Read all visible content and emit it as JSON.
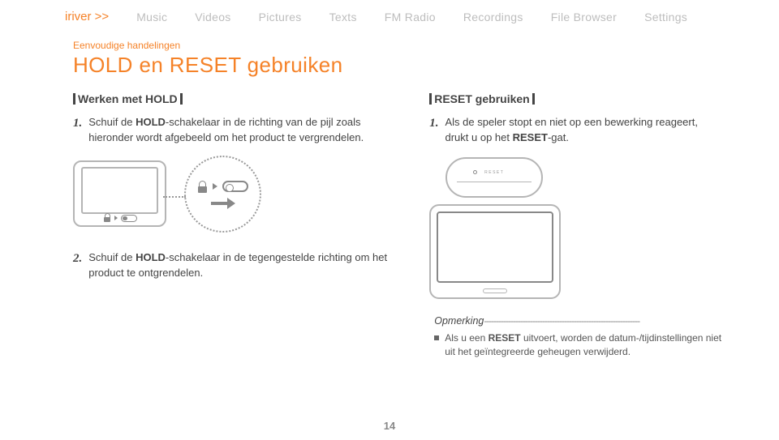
{
  "nav": {
    "brand": "iriver >>",
    "items": [
      "Music",
      "Videos",
      "Pictures",
      "Texts",
      "FM Radio",
      "Recordings",
      "File Browser",
      "Settings"
    ]
  },
  "section_label": "Eenvoudige handelingen",
  "page_title": "HOLD en RESET gebruiken",
  "left": {
    "subheader": "Werken met HOLD",
    "step1_num": "1.",
    "step1_prefix": "Schuif de ",
    "step1_bold": "HOLD",
    "step1_suffix": "-schakelaar in de richting van de pijl zoals hieronder wordt afgebeeld om het product te vergrendelen.",
    "step2_num": "2.",
    "step2_prefix": "Schuif de ",
    "step2_bold": "HOLD",
    "step2_suffix": "-schakelaar in de tegengestelde richting om het product te ontgrendelen."
  },
  "right": {
    "subheader": "RESET gebruiken",
    "step1_num": "1.",
    "step1_prefix": "Als de speler stopt en niet op een bewerking reageert, drukt u op het ",
    "step1_bold": "RESET",
    "step1_suffix": "-gat.",
    "reset_diagram_label": "RESET",
    "note_label": "Opmerking",
    "note_dashes": "----------------------------------------------------------------",
    "note_prefix": "Als u een ",
    "note_bold": "RESET",
    "note_suffix": " uitvoert, worden de datum-/tijdinstellingen niet uit het geïntegreerde geheugen verwijderd."
  },
  "page_number": "14"
}
